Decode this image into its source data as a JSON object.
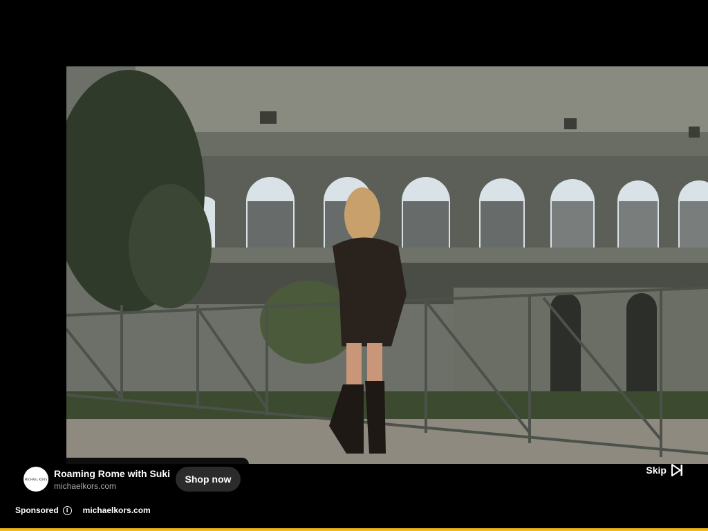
{
  "ad": {
    "logo_text": "MICHAEL KORS",
    "title": "Roaming Rome with Suki",
    "domain": "michaelkors.com",
    "cta_label": "Shop now",
    "skip_label": "Skip",
    "sponsored_label": "Sponsored",
    "sponsor_link": "michaelkors.com"
  },
  "progress": {
    "fraction": 1.0,
    "color": "#f2b818"
  },
  "icons": [
    "info-icon",
    "skip-next-icon"
  ]
}
